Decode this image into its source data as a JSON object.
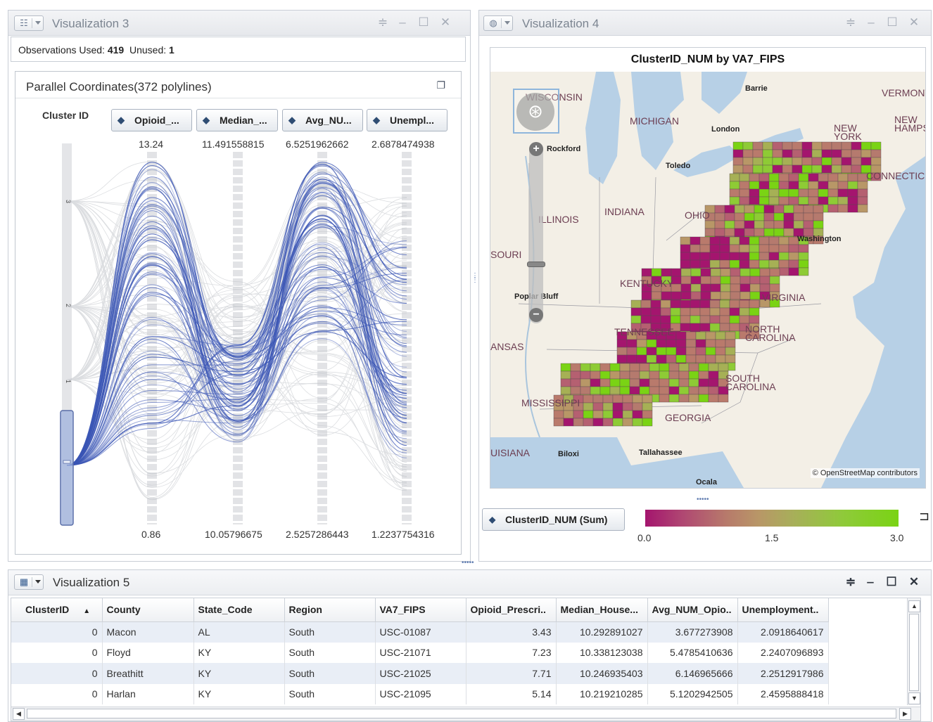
{
  "viz3": {
    "title": "Visualization 3",
    "observations_label": "Observations Used:",
    "observations_used": "419",
    "unused_label": "Unused:",
    "unused": "1",
    "pc_title": "Parallel Coordinates(372 polylines)",
    "cluster_label": "Cluster ID",
    "axes": [
      {
        "label": "Opioid_...",
        "max": "13.24",
        "min": "0.86"
      },
      {
        "label": "Median_...",
        "max": "11.491558815",
        "min": "10.05796675"
      },
      {
        "label": "Avg_NU...",
        "max": "6.5251962662",
        "min": "2.5257286443"
      },
      {
        "label": "Unempl...",
        "max": "2.6878474938",
        "min": "1.2237754316"
      }
    ],
    "cluster_ticks": [
      "3",
      "2",
      "1",
      "0"
    ],
    "line_color": "#3a55b5"
  },
  "viz4": {
    "title": "Visualization 4",
    "map_title": "ClusterID_NUM by VA7_FIPS",
    "credit": "© OpenStreetMap contributors",
    "state_labels": [
      "WISCONSIN",
      "MICHIGAN",
      "ILLINOIS",
      "INDIANA",
      "OHIO",
      "SOURI",
      "KENTUCKY",
      "VIRGINIA",
      "TENNESSEE",
      "NORTH CAROLINA",
      "SOUTH CAROLINA",
      "ANSAS",
      "MISSISSIPPI",
      "GEORGIA",
      "UISIANA",
      "NEW YORK",
      "VERMONT",
      "NEW HAMPSHIRE",
      "CONNECTICUT"
    ],
    "cities": [
      "Barrie",
      "London",
      "Rockford",
      "Toledo",
      "Washington",
      "Poplar Bluff",
      "Biloxi",
      "Tallahassee",
      "Ocala"
    ],
    "legend_button": "ClusterID_NUM (Sum)",
    "legend_min": "0.0",
    "legend_mid": "1.5",
    "legend_max": "3.0",
    "colors": {
      "low": "#a4156e",
      "mid": "#b89767",
      "high": "#7ad314"
    }
  },
  "viz5": {
    "title": "Visualization 5",
    "columns": [
      "ClusterID",
      "County",
      "State_Code",
      "Region",
      "VA7_FIPS",
      "Opioid_Prescri..",
      "Median_House...",
      "Avg_NUM_Opio..",
      "Unemployment.."
    ],
    "sort_indicator": "▲",
    "rows": [
      [
        "0",
        "Macon",
        "AL",
        "South",
        "USC-01087",
        "3.43",
        "10.292891027",
        "3.677273908",
        "2.0918640617"
      ],
      [
        "0",
        "Floyd",
        "KY",
        "South",
        "USC-21071",
        "7.23",
        "10.338123038",
        "5.4785410636",
        "2.2407096893"
      ],
      [
        "0",
        "Breathitt",
        "KY",
        "South",
        "USC-21025",
        "7.71",
        "10.246935403",
        "6.146965666",
        "2.2512917986"
      ],
      [
        "0",
        "Harlan",
        "KY",
        "South",
        "USC-21095",
        "5.14",
        "10.219210285",
        "5.1202942505",
        "2.4595888418"
      ]
    ]
  }
}
